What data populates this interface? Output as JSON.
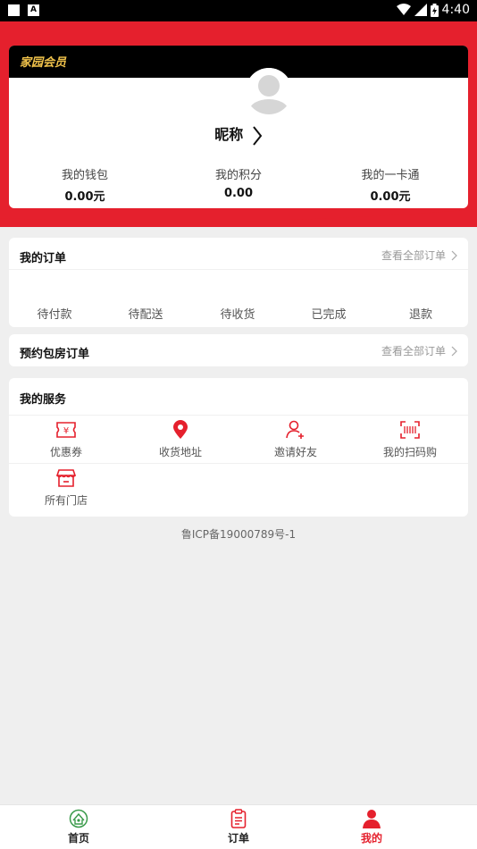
{
  "status_bar": {
    "time": "4:40",
    "notification_icon": "A"
  },
  "member": {
    "title": "家园会员",
    "nickname": "昵称",
    "stats": [
      {
        "label": "我的钱包",
        "value": "0.00元"
      },
      {
        "label": "我的积分",
        "value": "0.00"
      },
      {
        "label": "我的一卡通",
        "value": "0.00元"
      }
    ]
  },
  "orders": {
    "title": "我的订单",
    "view_all": "查看全部订单",
    "statuses": [
      "待付款",
      "待配送",
      "待收货",
      "已完成",
      "退款"
    ]
  },
  "room_orders": {
    "title": "预约包房订单",
    "view_all": "查看全部订单"
  },
  "services": {
    "title": "我的服务",
    "items": [
      {
        "label": "优惠券",
        "icon": "coupon-icon"
      },
      {
        "label": "收货地址",
        "icon": "location-pin-icon"
      },
      {
        "label": "邀请好友",
        "icon": "add-friend-icon"
      },
      {
        "label": "我的扫码购",
        "icon": "scan-barcode-icon"
      },
      {
        "label": "所有门店",
        "icon": "store-icon"
      }
    ]
  },
  "icp": "鲁ICP备19000789号-1",
  "tabbar": {
    "tabs": [
      {
        "label": "首页",
        "icon": "home-logo-icon",
        "active": false
      },
      {
        "label": "订单",
        "icon": "order-clipboard-icon",
        "active": false
      },
      {
        "label": "我的",
        "icon": "user-icon",
        "active": true
      }
    ]
  },
  "colors": {
    "accent": "#e5202d",
    "member_bar": "#000000",
    "member_title": "#f0c24b"
  }
}
